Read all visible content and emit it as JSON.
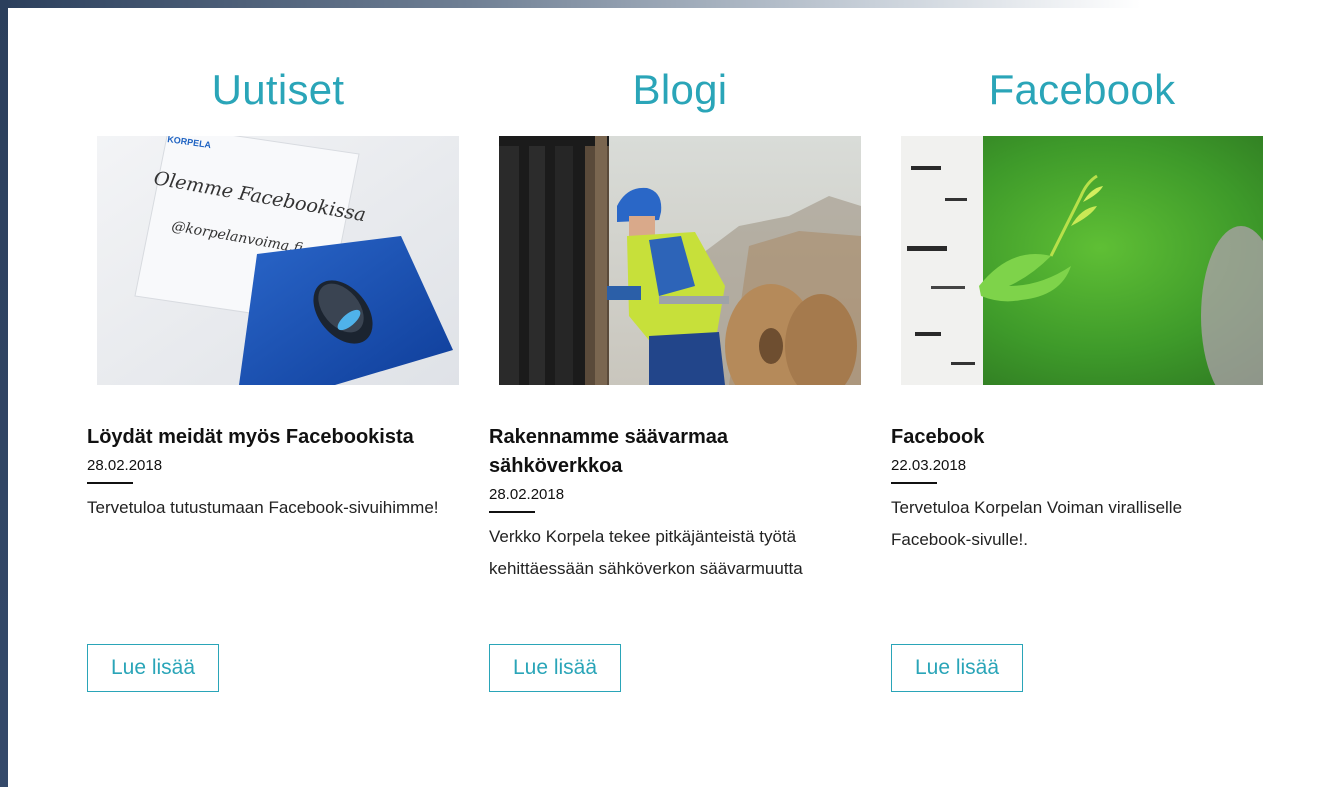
{
  "columns": [
    {
      "section_title": "Uutiset",
      "image_text": {
        "brand": "KORPELA",
        "line1": "Olemme Facebookissa",
        "line2": "@korpelanvoima.fi"
      },
      "post_title": "Löydät meidät myös Facebookista",
      "post_date": "28.02.2018",
      "post_text": "Tervetuloa tutustumaan Facebook-sivuihimme!",
      "button_label": "Lue lisää"
    },
    {
      "section_title": "Blogi",
      "post_title": "Rakennamme säävarmaa sähköverkkoa",
      "post_date": "28.02.2018",
      "post_text": "Verkko Korpela tekee pitkäjänteistä työtä kehittäessään sähköverkon säävarmuutta",
      "button_label": "Lue lisää"
    },
    {
      "section_title": "Facebook",
      "post_title": "Facebook",
      "post_date": "22.03.2018",
      "post_text": "Tervetuloa Korpelan Voiman viralliselle Facebook-sivulle!.",
      "button_label": "Lue lisää"
    }
  ],
  "colors": {
    "accent": "#2aa5b8",
    "text": "#111111",
    "frame": "#2b3f5c"
  }
}
